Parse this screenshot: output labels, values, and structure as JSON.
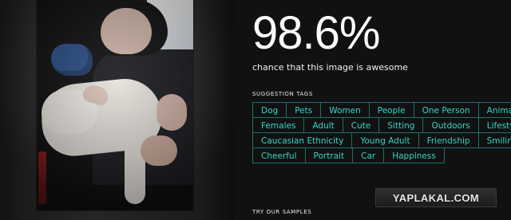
{
  "result": {
    "score_text": "98.6%",
    "subtitle": "chance that this image is awesome"
  },
  "suggestion": {
    "title": "SUGGESTION TAGS",
    "rows": [
      [
        "Dog",
        "Pets",
        "Women",
        "People",
        "One Person",
        "Animal"
      ],
      [
        "Females",
        "Adult",
        "Cute",
        "Sitting",
        "Outdoors",
        "Lifestyles"
      ],
      [
        "Caucasian Ethnicity",
        "Young Adult",
        "Friendship",
        "Smiling"
      ],
      [
        "Cheerful",
        "Portrait",
        "Car",
        "Happiness"
      ]
    ]
  },
  "samples": {
    "title": "TRY OUR SAMPLES"
  },
  "watermark": {
    "text": "YAPLAKAL.COM"
  },
  "colors": {
    "background": "#111111",
    "tag_text": "#37d5c6",
    "tag_border": "#1f6f6a"
  }
}
